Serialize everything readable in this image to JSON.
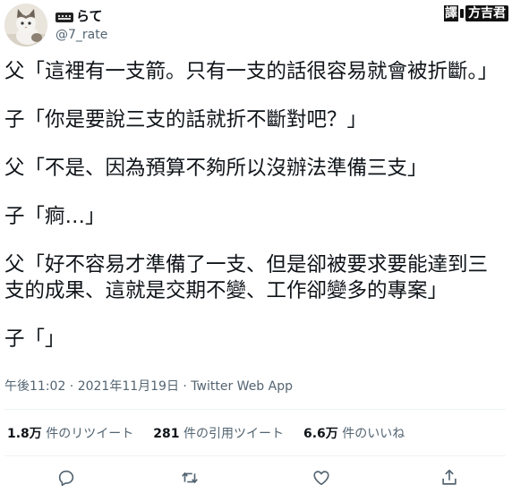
{
  "author": {
    "display_name": "らて",
    "handle": "@7_rate"
  },
  "watermark": {
    "prefix": "譯",
    "name": "方吉君"
  },
  "tweet": {
    "lines": [
      "父「這裡有一支箭。只有一支的話很容易就會被折斷。」",
      "子「你是要說三支的話就折不斷對吧？」",
      "父「不是、因為預算不夠所以沒辦法準備三支」",
      "子「痾…」",
      "父「好不容易才準備了一支、但是卻被要求要能達到三支的成果、這就是交期不變、工作卻變多的專案」",
      "子「」"
    ]
  },
  "meta": {
    "timestamp": "午後11:02 · 2021年11月19日 · Twitter Web App"
  },
  "stats": {
    "retweets_count": "1.8万",
    "retweets_label": "件のリツイート",
    "quotes_count": "281",
    "quotes_label": "件の引用ツイート",
    "likes_count": "6.6万",
    "likes_label": "件のいいね"
  },
  "icons": {
    "reply": "reply-icon",
    "retweet": "retweet-icon",
    "like": "heart-icon",
    "share": "share-icon"
  },
  "colors": {
    "text": "#0f1419",
    "secondary": "#536471",
    "divider": "#eff3f4"
  }
}
